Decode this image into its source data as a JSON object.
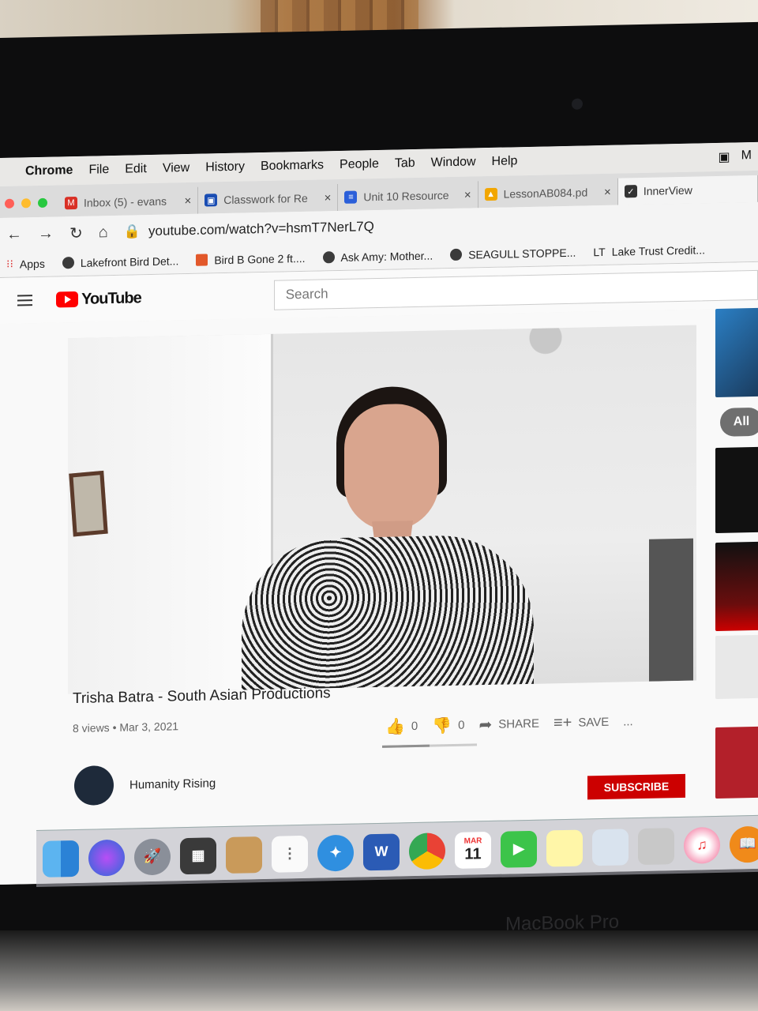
{
  "menubar": {
    "app_name": "Chrome",
    "items": [
      "File",
      "Edit",
      "View",
      "History",
      "Bookmarks",
      "People",
      "Tab",
      "Window",
      "Help"
    ]
  },
  "tabs": [
    {
      "title": "Inbox (5) - evans",
      "icon": "gmail-icon",
      "color": "#d93025"
    },
    {
      "title": "Classwork for Re",
      "icon": "classroom-icon",
      "color": "#1a4db3"
    },
    {
      "title": "Unit 10 Resource",
      "icon": "docs-icon",
      "color": "#2b5fd9"
    },
    {
      "title": "LessonAB084.pd",
      "icon": "drive-icon",
      "color": "#f2a600"
    },
    {
      "title": "InnerView",
      "icon": "innerview-icon",
      "color": "#333333"
    }
  ],
  "toolbar": {
    "url": "youtube.com/watch?v=hsmT7NerL7Q"
  },
  "bookmarks": [
    "Apps",
    "Lakefront Bird Det...",
    "Bird B Gone 2 ft....",
    "Ask Amy: Mother...",
    "SEAGULL STOPPE...",
    "Lake Trust Credit..."
  ],
  "youtube": {
    "logo_text": "YouTube",
    "search_placeholder": "Search",
    "video": {
      "title": "Trisha Batra - South Asian Productions",
      "meta": "8 views • Mar 3, 2021",
      "likes": "0",
      "dislikes": "0",
      "share_label": "SHARE",
      "save_label": "SAVE",
      "more_label": "..."
    },
    "channel": {
      "name": "Humanity Rising",
      "subscribe_label": "SUBSCRIBE"
    },
    "sidebar_chip": "All"
  },
  "dock": {
    "calendar_month": "MAR",
    "calendar_day": "11",
    "word_label": "W"
  },
  "device_label": "MacBook Pro",
  "colors": {
    "youtube_red": "#ff0000",
    "subscribe_red": "#cc0000",
    "traffic_close": "#ff5f57",
    "traffic_min": "#febc2e",
    "traffic_max": "#28c840"
  }
}
